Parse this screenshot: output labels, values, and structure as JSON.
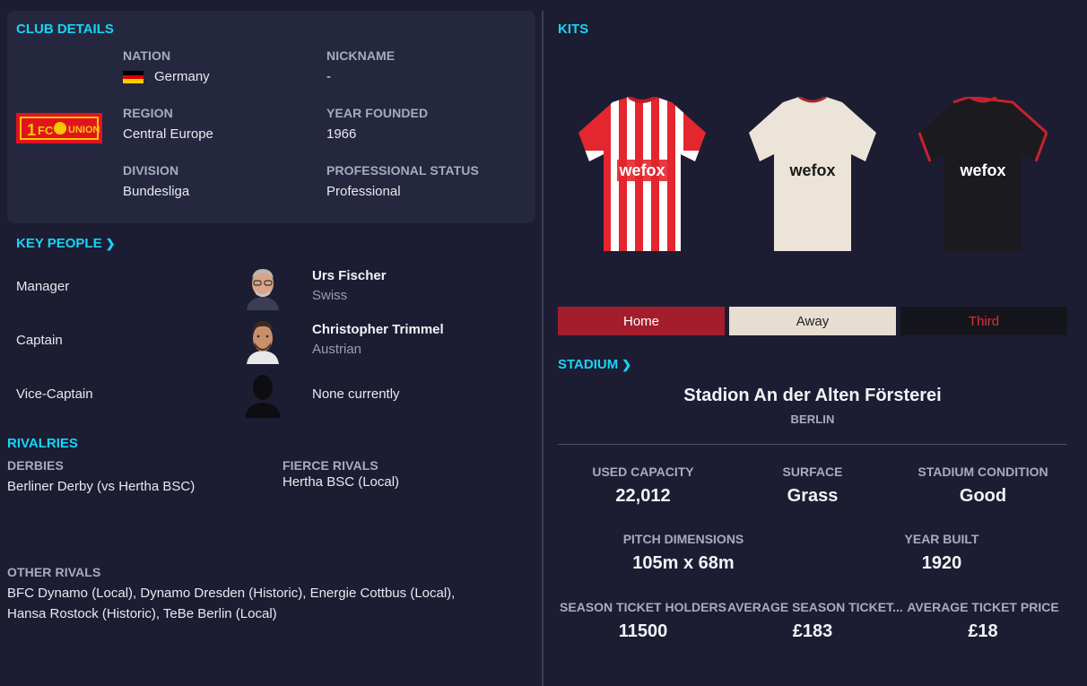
{
  "club_details": {
    "heading": "CLUB DETAILS",
    "nation_label": "NATION",
    "nation": "Germany",
    "nickname_label": "NICKNAME",
    "nickname": "-",
    "region_label": "REGION",
    "region": "Central Europe",
    "year_founded_label": "YEAR FOUNDED",
    "year_founded": "1966",
    "division_label": "DIVISION",
    "division": "Bundesliga",
    "status_label": "PROFESSIONAL STATUS",
    "status": "Professional"
  },
  "key_people": {
    "heading": "KEY PEOPLE",
    "people": [
      {
        "role": "Manager",
        "name": "Urs Fischer",
        "sub": "Swiss"
      },
      {
        "role": "Captain",
        "name": "Christopher Trimmel",
        "sub": "Austrian"
      },
      {
        "role": "Vice-Captain",
        "name": "None currently",
        "sub": ""
      }
    ]
  },
  "rivalries": {
    "heading": "RIVALRIES",
    "derbies_label": "DERBIES",
    "derbies": "Berliner Derby (vs Hertha BSC)",
    "fierce_label": "FIERCE RIVALS",
    "fierce": "Hertha BSC (Local)",
    "other_label": "OTHER RIVALS",
    "other_line1": "BFC Dynamo (Local), Dynamo Dresden (Historic), Energie Cottbus (Local),",
    "other_line2": "Hansa Rostock (Historic), TeBe Berlin (Local)"
  },
  "kits": {
    "heading": "KITS",
    "sponsor": "wefox",
    "buttons": {
      "home": "Home",
      "away": "Away",
      "third": "Third"
    },
    "colors": {
      "home_btn": "#a31d2c",
      "away_btn": "#e7ddd0",
      "third_btn": "#15151c",
      "third_text": "#d8303f"
    }
  },
  "stadium": {
    "heading": "STADIUM",
    "name": "Stadion An der Alten Försterei",
    "city": "BERLIN",
    "used_capacity_label": "USED CAPACITY",
    "used_capacity": "22,012",
    "surface_label": "SURFACE",
    "surface": "Grass",
    "condition_label": "STADIUM CONDITION",
    "condition": "Good",
    "pitch_label": "PITCH DIMENSIONS",
    "pitch": "105m x 68m",
    "year_built_label": "YEAR BUILT",
    "year_built": "1920",
    "season_holders_label": "SEASON TICKET HOLDERS",
    "season_holders": "11500",
    "avg_season_label": "AVERAGE SEASON TICKET...",
    "avg_season": "£183",
    "avg_ticket_label": "AVERAGE TICKET PRICE",
    "avg_ticket": "£18"
  },
  "colors": {
    "accent": "#19d3f5",
    "background": "#1c1d33",
    "card": "#25273f"
  }
}
